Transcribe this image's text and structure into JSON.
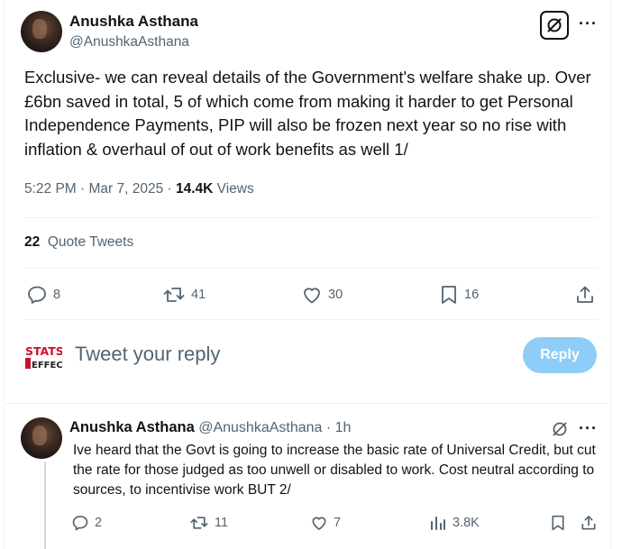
{
  "main_tweet": {
    "author_name": "Anushka Asthana",
    "author_handle": "@AnushkaAsthana",
    "text": "Exclusive- we can reveal details of the Government's welfare shake up. Over £6bn saved in total, 5 of which come from making it harder to get Personal Independence Payments, PIP will also be frozen next year so no rise with inflation & overhaul of out of work benefits as well 1/",
    "time": "5:22 PM · Mar 7, 2025 · ",
    "views_count": "14.4K",
    "views_label": " Views",
    "quote_tweets_count": "22",
    "quote_tweets_label": "Quote Tweets",
    "actions": {
      "replies": "8",
      "retweets": "41",
      "likes": "30",
      "bookmarks": "16"
    }
  },
  "composer": {
    "logo_line1": "STATS",
    "logo_line2": "EFFECT",
    "placeholder": "Tweet your reply",
    "button_label": "Reply"
  },
  "reply_tweet": {
    "author_name": "Anushka Asthana",
    "author_handle": "@AnushkaAsthana",
    "separator": " · ",
    "time": "1h",
    "text": "Ive heard that the Govt is going to increase the basic rate of Universal Credit, but cut the rate for those judged as too unwell or disabled to work. Cost neutral according to sources, to incentivise work BUT 2/",
    "actions": {
      "replies": "2",
      "retweets": "11",
      "likes": "7",
      "views": "3.8K"
    }
  },
  "icons": [
    "grok-icon",
    "more-icon",
    "reply-icon",
    "retweet-icon",
    "like-icon",
    "bookmark-icon",
    "share-icon",
    "views-icon"
  ],
  "colors": {
    "accent_disabled": "#8ecdf7",
    "muted_text": "#536471",
    "text": "#0f1419",
    "divider": "#eff3f4"
  }
}
